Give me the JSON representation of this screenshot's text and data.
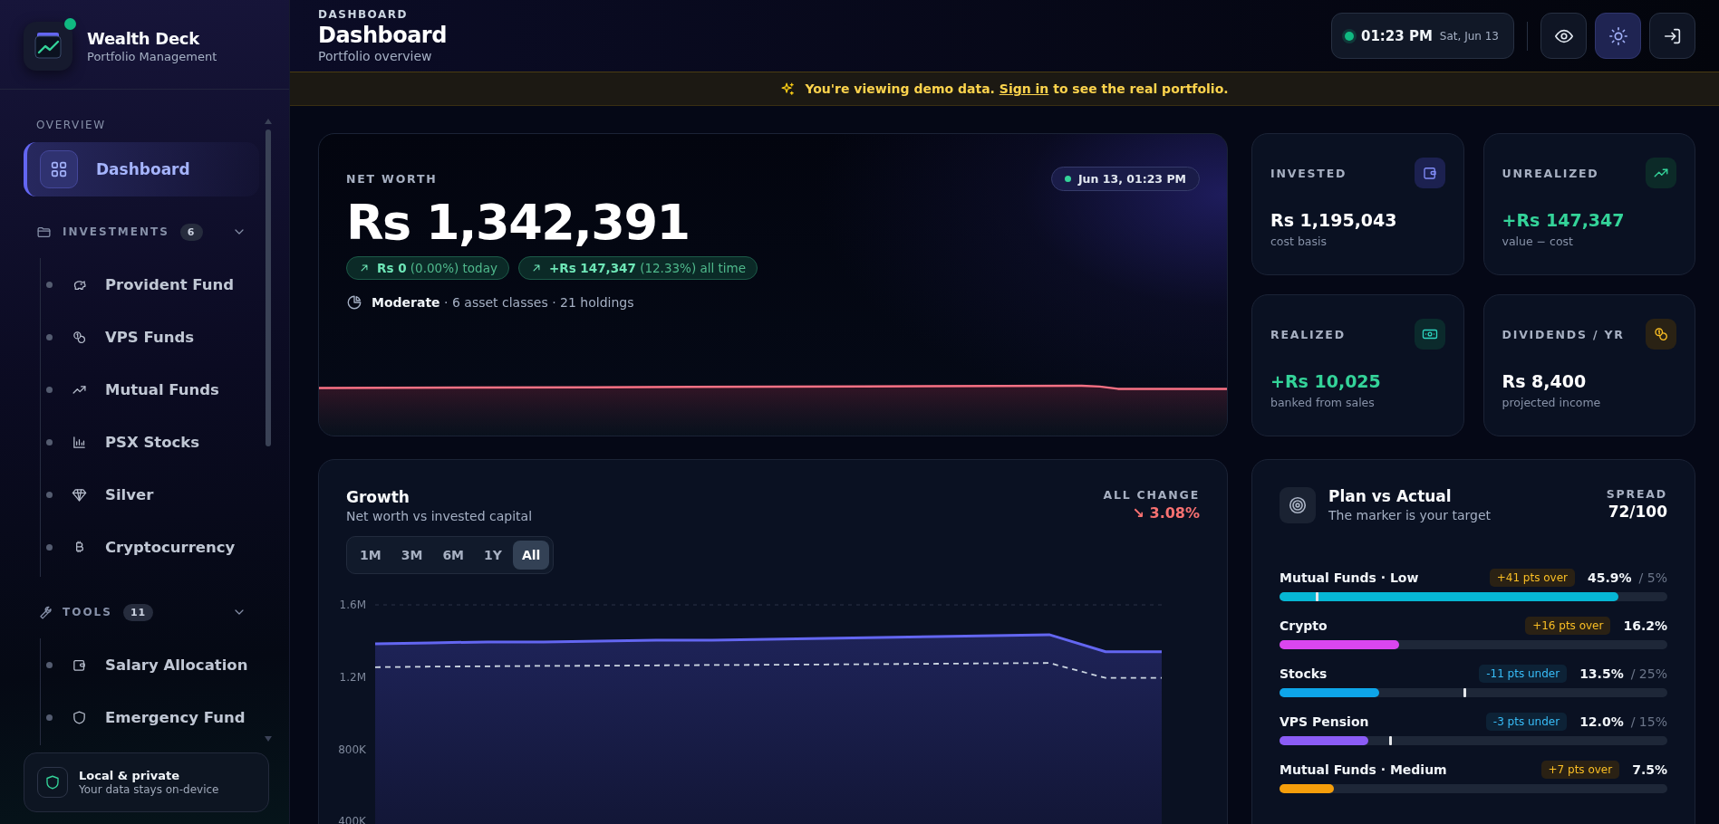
{
  "sidebar": {
    "brand": {
      "title": "Wealth Deck",
      "subtitle": "Portfolio Management",
      "online": true
    },
    "sections": [
      {
        "kind": "flat",
        "label": "OVERVIEW",
        "items": [
          {
            "label": "Dashboard",
            "selected": true
          }
        ]
      },
      {
        "kind": "group",
        "label": "INVESTMENTS",
        "count": "6",
        "expanded": true,
        "items": [
          {
            "label": "Provident Fund",
            "selected": false
          },
          {
            "label": "VPS Funds",
            "selected": false
          },
          {
            "label": "Mutual Funds",
            "selected": false
          },
          {
            "label": "PSX Stocks",
            "selected": false
          },
          {
            "label": "Silver",
            "selected": false
          },
          {
            "label": "Cryptocurrency",
            "selected": false
          }
        ]
      },
      {
        "kind": "group",
        "label": "TOOLS",
        "count": "11",
        "expanded": true,
        "items": [
          {
            "label": "Salary Allocation",
            "selected": false
          },
          {
            "label": "Emergency Fund",
            "selected": false
          }
        ]
      }
    ],
    "footer": {
      "title": "Local & private",
      "subtitle": "Your data stays on-device"
    }
  },
  "header": {
    "eyebrow": "DASHBOARD",
    "title": "Dashboard",
    "subtitle": "Portfolio overview",
    "clock": {
      "time": "01:23 PM",
      "date": "Sat, Jun 13",
      "live": true
    },
    "buttons": [
      {
        "on": false
      },
      {
        "on": true
      },
      {
        "on": false
      }
    ]
  },
  "banner": {
    "before": "You're viewing demo data.",
    "link": "Sign in",
    "after": "to see the real portfolio."
  },
  "net_worth": {
    "label": "NET WORTH",
    "timestamp": "Jun 13, 01:23 PM",
    "value": "Rs 1,342,391",
    "chips": [
      {
        "text": "**Rs 0** (0.00%) today"
      },
      {
        "text": "**+Rs 147,347** (12.33%) all time"
      }
    ],
    "meta": "**Moderate** · 6 asset classes · 21 holdings"
  },
  "stats": [
    {
      "label": "INVESTED",
      "value": "Rs 1,195,043",
      "sub": "cost basis",
      "positive": false
    },
    {
      "label": "UNREALIZED",
      "value": "+Rs 147,347",
      "sub": "value − cost",
      "positive": true
    },
    {
      "label": "REALIZED",
      "value": "+Rs 10,025",
      "sub": "banked from sales",
      "positive": true
    },
    {
      "label": "DIVIDENDS / YR",
      "value": "Rs 8,400",
      "sub": "projected income",
      "positive": false
    }
  ],
  "growth": {
    "title": "Growth",
    "subtitle": "Net worth vs invested capital",
    "change_label": "ALL CHANGE",
    "change": "↘ 3.08%",
    "ranges": [
      {
        "label": "1M",
        "selected": false
      },
      {
        "label": "3M",
        "selected": false
      },
      {
        "label": "6M",
        "selected": false
      },
      {
        "label": "1Y",
        "selected": false
      },
      {
        "label": "All",
        "selected": true
      }
    ],
    "chart_data": {
      "type": "area",
      "ylim": [
        356000,
        1600000
      ],
      "yticks": [
        {
          "value": 1600000,
          "label": "1.6M"
        },
        {
          "value": 1200000,
          "label": "1.2M"
        },
        {
          "value": 800000,
          "label": "800K"
        },
        {
          "value": 400000,
          "label": "400K"
        }
      ],
      "series": [
        {
          "color": "#6366f1",
          "line_style": "solid",
          "values": [
            1385000,
            1390000,
            1395000,
            1395000,
            1400000,
            1405000,
            1405000,
            1410000,
            1415000,
            1420000,
            1425000,
            1430000,
            1435000,
            1340000,
            1340000
          ]
        },
        {
          "type": "line",
          "color": "#cbd5e1",
          "line_style": "dashed",
          "values": [
            1255000,
            1258000,
            1260000,
            1262000,
            1263000,
            1265000,
            1267000,
            1268000,
            1270000,
            1272000,
            1274000,
            1276000,
            1278000,
            1195000,
            1195000
          ]
        }
      ]
    }
  },
  "plan": {
    "title": "Plan vs Actual",
    "subtitle": "The marker is your target",
    "spread_label": "SPREAD",
    "spread": "72/100",
    "rows": [
      {
        "name": "Mutual Funds · Low",
        "badge": "+41 pts over",
        "kind": "over",
        "actual": "45.9%",
        "target": "/ 5%",
        "color": "#06b6d4",
        "level": 0.874,
        "marker": {
          "level": 0.095
        }
      },
      {
        "name": "Crypto",
        "badge": "+16 pts over",
        "kind": "over",
        "actual": "16.2%",
        "color": "#d946ef",
        "level": 0.308
      },
      {
        "name": "Stocks",
        "badge": "-11 pts under",
        "kind": "under",
        "actual": "13.5%",
        "target": "/ 25%",
        "color": "#0ea5e9",
        "level": 0.257,
        "marker": {
          "level": 0.476
        }
      },
      {
        "name": "VPS Pension",
        "badge": "-3 pts under",
        "kind": "under",
        "actual": "12.0%",
        "target": "/ 15%",
        "color": "#8b5cf6",
        "level": 0.228,
        "marker": {
          "level": 0.286
        }
      },
      {
        "name": "Mutual Funds · Medium",
        "badge": "+7 pts over",
        "kind": "over",
        "actual": "7.5%",
        "color": "#f59e0b",
        "level": 0.141
      }
    ]
  }
}
